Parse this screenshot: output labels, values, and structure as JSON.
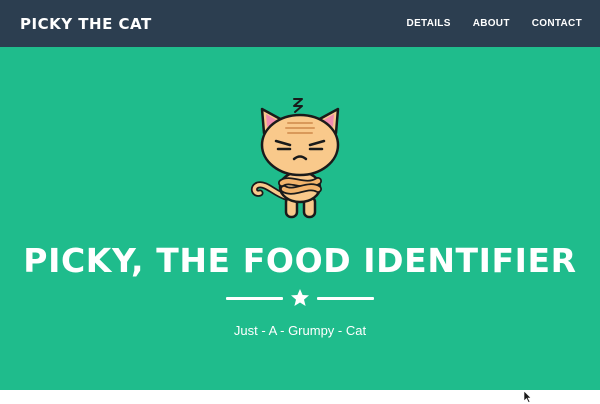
{
  "navbar": {
    "brand": "PICKY THE CAT",
    "links": [
      "DETAILS",
      "ABOUT",
      "CONTACT"
    ]
  },
  "masthead": {
    "image": "grumpy-cat-illustration",
    "title": "PICKY, THE FOOD IDENTIFIER",
    "divider_icon": "star-icon",
    "subtitle": "Just - A - Grumpy - Cat"
  },
  "colors": {
    "navbar_bg": "#2c3e50",
    "masthead_bg": "#1fbc8c",
    "text": "#ffffff",
    "cat_fur": "#f9c98b",
    "cat_ear_inner": "#f08bb0"
  }
}
